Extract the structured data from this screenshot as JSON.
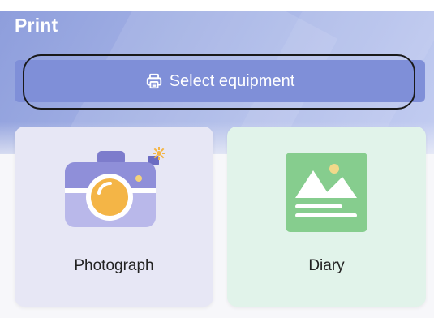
{
  "header": {
    "title": "Print",
    "select_button": {
      "label": "Select equipment",
      "icon": "printer-icon"
    }
  },
  "cards": [
    {
      "label": "Photograph",
      "icon": "camera-icon"
    },
    {
      "label": "Diary",
      "icon": "image-document-icon"
    }
  ],
  "colors": {
    "header_gradient_start": "#8e9edc",
    "header_gradient_end": "#c3cdf1",
    "button": "#7f8fd8",
    "card_photo": "#e7e7f5",
    "card_diary": "#e1f3ea",
    "camera_body": "#8f8fd9",
    "camera_lens": "#f4b546",
    "diary_icon": "#86cd8e"
  }
}
